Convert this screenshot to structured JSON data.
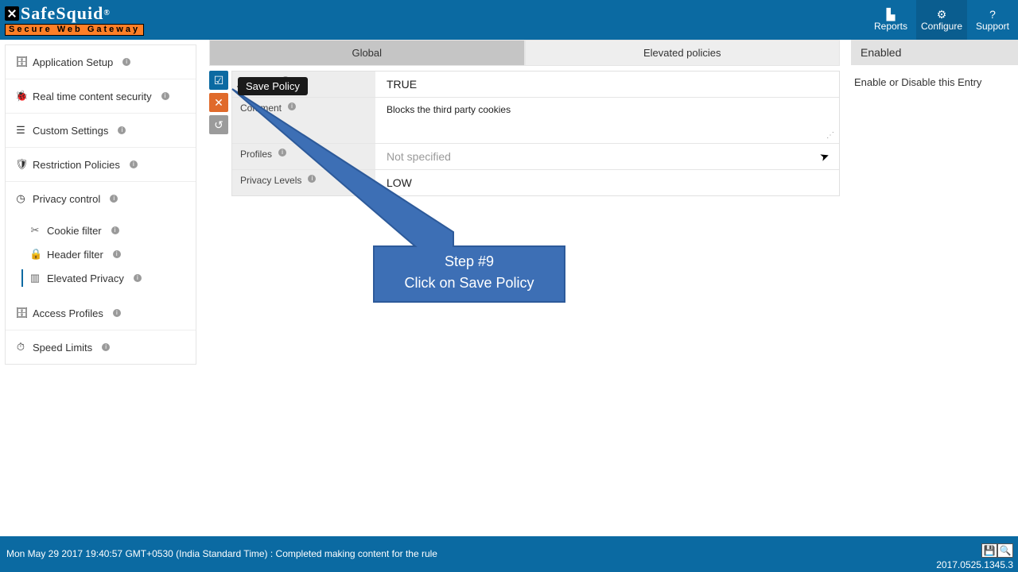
{
  "brand": {
    "name": "SafeSquid",
    "reg": "®",
    "tagline": "Secure Web Gateway"
  },
  "topnav": {
    "reports": "Reports",
    "configure": "Configure",
    "support": "Support"
  },
  "sidebar": {
    "items": [
      {
        "label": "Application Setup"
      },
      {
        "label": "Real time content security"
      },
      {
        "label": "Custom Settings"
      },
      {
        "label": "Restriction Policies"
      }
    ],
    "privacy": {
      "label": "Privacy control",
      "children": [
        {
          "label": "Cookie filter"
        },
        {
          "label": "Header filter"
        },
        {
          "label": "Elevated Privacy"
        }
      ]
    },
    "items_after": [
      {
        "label": "Access Profiles"
      },
      {
        "label": "Speed Limits"
      }
    ]
  },
  "tabs": {
    "global": "Global",
    "elevated": "Elevated policies"
  },
  "form": {
    "enabled_label": "Enabled",
    "enabled_value": "TRUE",
    "comment_label": "Comment",
    "comment_value": "Blocks the third party cookies",
    "profiles_label": "Profiles",
    "profiles_placeholder": "Not specified",
    "levels_label": "Privacy Levels",
    "levels_value": "LOW"
  },
  "tooltip": "Save Policy",
  "right_pane": {
    "title": "Enabled",
    "desc": "Enable or Disable this Entry"
  },
  "callout": {
    "line1": "Step #9",
    "line2": "Click on Save Policy"
  },
  "footer": {
    "status": "Mon May 29 2017 19:40:57 GMT+0530 (India Standard Time) : Completed making content for the rule",
    "version": "2017.0525.1345.3"
  }
}
